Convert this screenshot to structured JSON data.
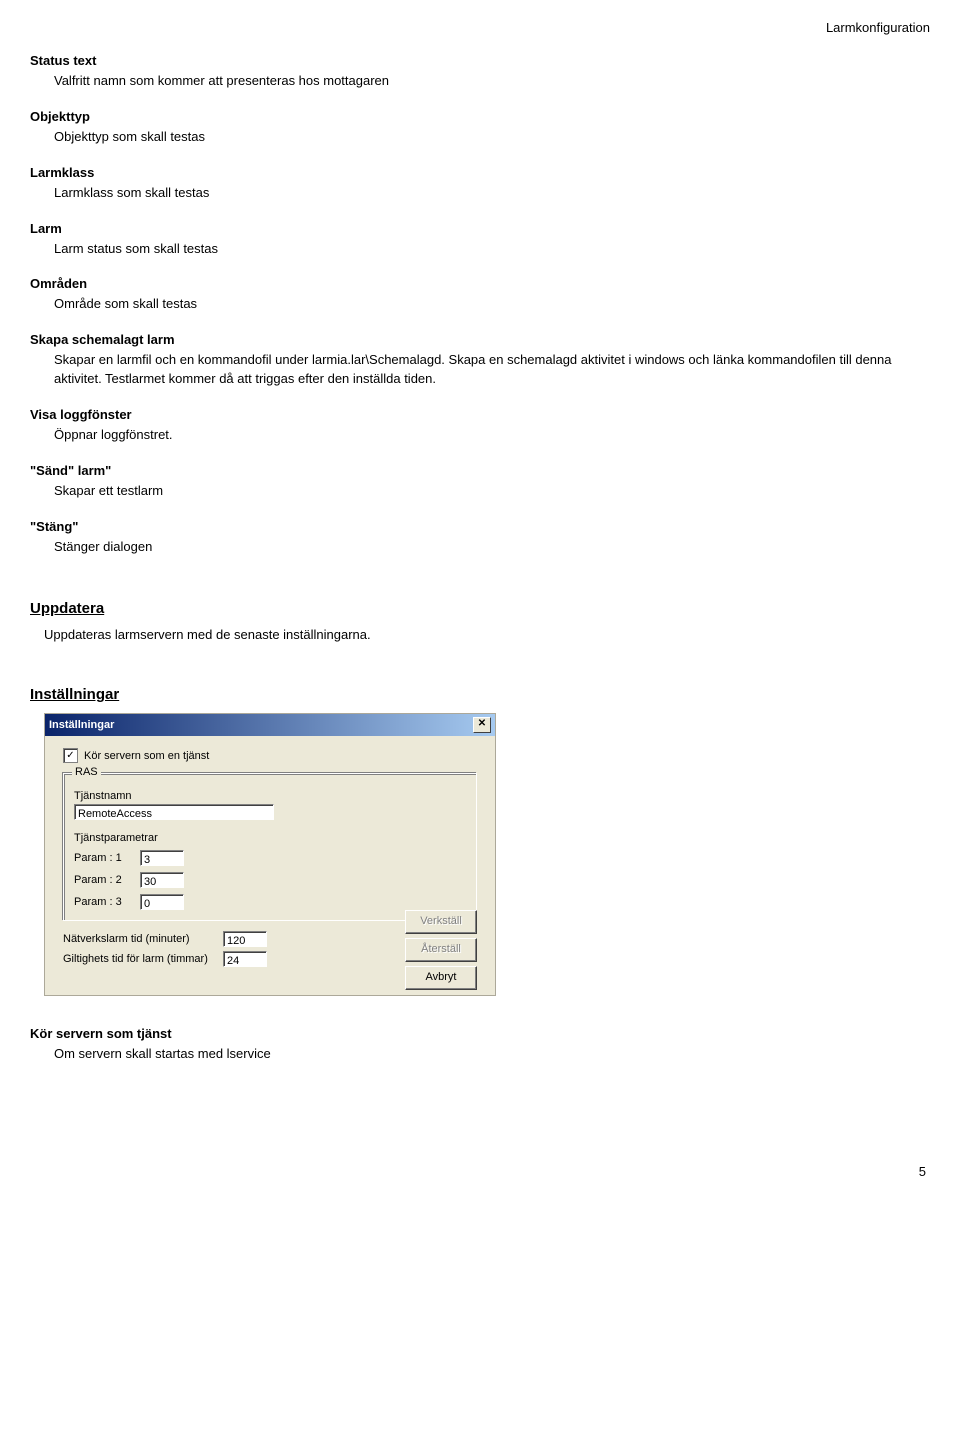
{
  "header": "Larmkonfiguration",
  "sections": [
    {
      "title": "Status text",
      "body": "Valfritt namn som kommer att presenteras hos mottagaren"
    },
    {
      "title": "Objekttyp",
      "body": "Objekttyp som skall testas"
    },
    {
      "title": "Larmklass",
      "body": "Larmklass som skall testas"
    },
    {
      "title": "Larm",
      "body": "Larm status som skall testas"
    },
    {
      "title": "Områden",
      "body": "Område som skall testas"
    },
    {
      "title": "Skapa schemalagt larm",
      "body": "Skapar en larmfil och en kommandofil under larmia.lar\\Schemalagd. Skapa en schemalagd aktivitet i windows och länka kommandofilen till denna aktivitet. Testlarmet kommer då att triggas efter den inställda tiden."
    },
    {
      "title": "Visa loggfönster",
      "body": "Öppnar loggfönstret."
    },
    {
      "title": "\"Sänd\" larm\"",
      "body": "Skapar ett testlarm"
    },
    {
      "title": "\"Stäng\"",
      "body": "Stänger dialogen"
    }
  ],
  "uppdatera": {
    "title": "Uppdatera",
    "body": "Uppdateras larmservern med de senaste inställningarna."
  },
  "installningar": {
    "title": "Inställningar"
  },
  "dialog": {
    "title": "Inställningar",
    "checkbox_label": "Kör servern som en tjänst",
    "checkbox_checked": "✓",
    "group_title": "RAS",
    "tjanstnamn_label": "Tjänstnamn",
    "tjanstnamn_value": "RemoteAccess",
    "tjanstparametrar_label": "Tjänstparametrar",
    "params": [
      {
        "label": "Param : 1",
        "value": "3"
      },
      {
        "label": "Param : 2",
        "value": "30"
      },
      {
        "label": "Param : 3",
        "value": "0"
      }
    ],
    "natverkslarm_label": "Nätverkslarm tid (minuter)",
    "natverkslarm_value": "120",
    "giltighet_label": "Giltighets tid för larm (timmar)",
    "giltighet_value": "24",
    "buttons": {
      "verkstall": "Verkställ",
      "aterstall": "Återställ",
      "avbryt": "Avbryt"
    }
  },
  "footer_section": {
    "title": "Kör servern som tjänst",
    "body": "Om servern skall startas med lservice"
  },
  "page_number": "5"
}
